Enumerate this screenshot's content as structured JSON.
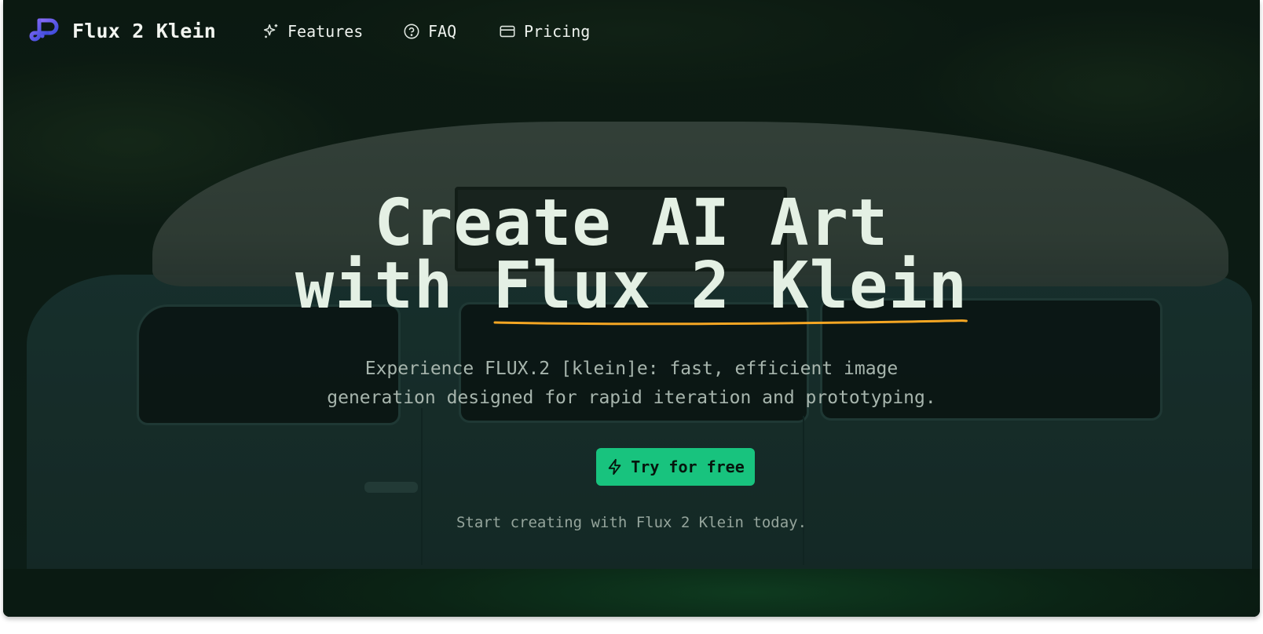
{
  "brand": {
    "name": "Flux 2 Klein",
    "logo_icon": "flux-logo-icon",
    "logo_colors": [
      "#7c5cf5",
      "#3b4fd8"
    ]
  },
  "nav": {
    "items": [
      {
        "label": "Features",
        "icon": "sparkles-icon"
      },
      {
        "label": "FAQ",
        "icon": "help-circle-icon"
      },
      {
        "label": "Pricing",
        "icon": "credit-card-icon"
      }
    ]
  },
  "hero": {
    "headline_line1": "Create AI Art",
    "headline_line2_prefix": "with ",
    "headline_line2_accent": "Flux 2 Klein",
    "underline_color": "#f5a623",
    "subtitle_line1": "Experience FLUX.2 [klein]e: fast, efficient image",
    "subtitle_line2": "generation designed for rapid iteration and prototyping.",
    "cta_label": "Try for free",
    "cta_icon": "zap-icon",
    "cta_color": "#18c37e",
    "tagline": "Start creating with Flux 2 Klein today."
  }
}
